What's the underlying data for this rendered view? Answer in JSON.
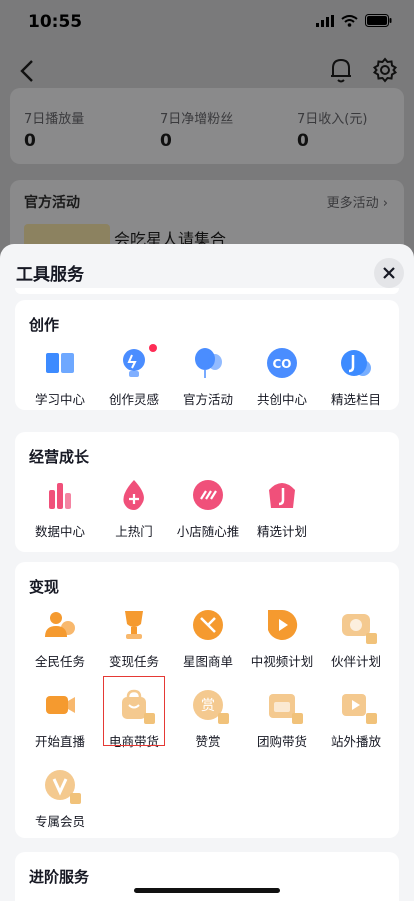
{
  "status_bar": {
    "time": "10:55"
  },
  "stats": [
    {
      "label": "7日播放量",
      "value": "0"
    },
    {
      "label": "7日净增粉丝",
      "value": "0"
    },
    {
      "label": "7日收入(元)",
      "value": "0"
    }
  ],
  "activity": {
    "title": "官方活动",
    "more": "更多活动 ›",
    "item_name": "会吃星人请集合"
  },
  "sheet": {
    "title": "工具服务",
    "sections": [
      {
        "title": "创作",
        "items": [
          {
            "label": "学习中心",
            "icon": "book-icon",
            "color": "#3d8bff"
          },
          {
            "label": "创作灵感",
            "icon": "lightbulb-icon",
            "color": "#4a8dff",
            "dot": true
          },
          {
            "label": "官方活动",
            "icon": "balloon-icon",
            "color": "#4a8dff"
          },
          {
            "label": "共创中心",
            "icon": "co-create-icon",
            "color": "#4a8dff"
          },
          {
            "label": "精选栏目",
            "icon": "tiktok-column-icon",
            "color": "#3d8bff"
          }
        ]
      },
      {
        "title": "经营成长",
        "items": [
          {
            "label": "数据中心",
            "icon": "bar-chart-icon",
            "color": "#f0507a"
          },
          {
            "label": "上热门",
            "icon": "flame-plus-icon",
            "color": "#f0507a"
          },
          {
            "label": "小店随心推",
            "icon": "boost-icon",
            "color": "#f0507a"
          },
          {
            "label": "精选计划",
            "icon": "tiktok-plan-icon",
            "color": "#f0507a"
          }
        ]
      },
      {
        "title": "变现",
        "items": [
          {
            "label": "全民任务",
            "icon": "people-task-icon",
            "color": "#f59a2f"
          },
          {
            "label": "变现任务",
            "icon": "trophy-icon",
            "color": "#f59a2f"
          },
          {
            "label": "星图商单",
            "icon": "star-map-icon",
            "color": "#f59a2f"
          },
          {
            "label": "中视频计划",
            "icon": "play-video-icon",
            "color": "#f59a2f"
          },
          {
            "label": "伙伴计划",
            "icon": "partner-icon",
            "color": "#f4c98f",
            "locked": true
          },
          {
            "label": "开始直播",
            "icon": "live-camera-icon",
            "color": "#f59a2f"
          },
          {
            "label": "电商带货",
            "icon": "shopping-bag-icon",
            "color": "#f4c98f",
            "locked": true,
            "highlight": true
          },
          {
            "label": "赞赏",
            "icon": "reward-icon",
            "color": "#f4c98f",
            "locked": true
          },
          {
            "label": "团购带货",
            "icon": "group-buy-icon",
            "color": "#f4c98f",
            "locked": true
          },
          {
            "label": "站外播放",
            "icon": "external-play-icon",
            "color": "#f4c98f",
            "locked": true
          },
          {
            "label": "专属会员",
            "icon": "vip-icon",
            "color": "#f4c98f",
            "locked": true
          }
        ]
      },
      {
        "title": "进阶服务",
        "items": []
      }
    ]
  },
  "colors": {
    "accent_red": "#fe2c55",
    "highlight_border": "#e53935"
  }
}
